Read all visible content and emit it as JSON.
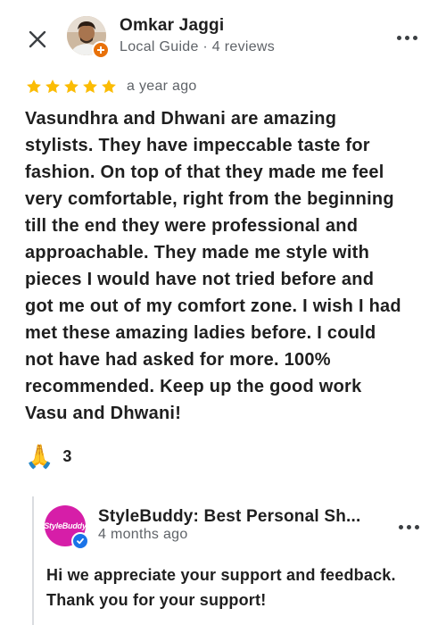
{
  "header": {
    "reviewer_name": "Omkar Jaggi",
    "reviewer_meta": "Local Guide · 4 reviews",
    "close_icon": "close-icon",
    "more_icon": "more-horizontal-icon"
  },
  "review": {
    "rating": 5,
    "rating_max": 5,
    "time": "a year ago",
    "text": "Vasundhra and Dhwani are amazing\nstylists. They have impeccable taste for\nfashion. On top of that they made me feel\nvery comfortable, right from the beginning\ntill the end they were professional and\napproachable. They made me style with\npieces I would have not tried before and\ngot me out of my comfort zone. I wish I had\nmet these amazing ladies before. I could\nnot have had asked for more. 100%\nrecommended. Keep up the good work\nVasu and Dhwani!"
  },
  "reaction": {
    "emoji": "🙏",
    "count": "3"
  },
  "owner_response": {
    "business_name": "StyleBuddy: Best Personal Sh...",
    "logo_text": "StyleBuddy",
    "time": "4 months ago",
    "text": "Hi we appreciate your support and feedback.\nThank you for your support!"
  },
  "colors": {
    "star": "#fbbc04",
    "guide_badge": "#e8710a",
    "verified_badge": "#1a73e8",
    "brand_logo": "#d61ea8",
    "secondary_text": "#5f6368"
  }
}
